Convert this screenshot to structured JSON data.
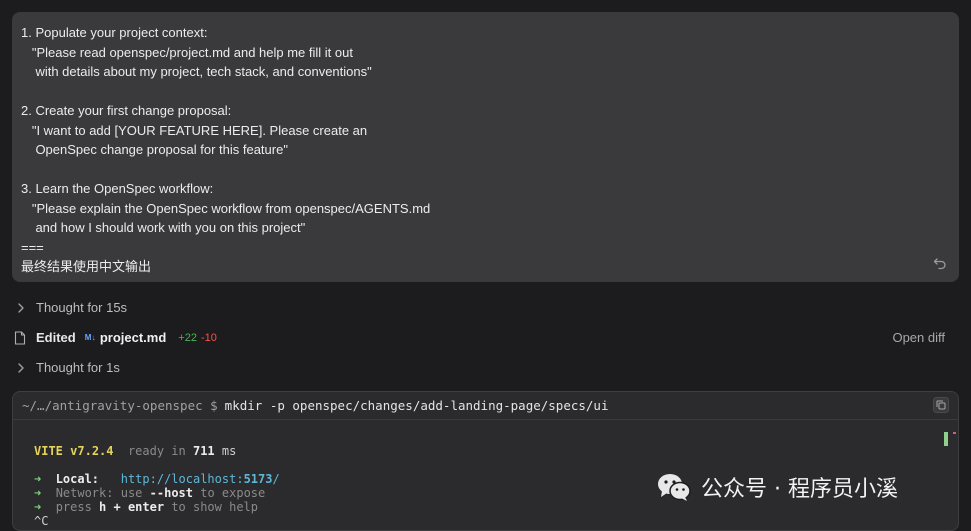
{
  "prompt": {
    "text": "1. Populate your project context:\n   \"Please read openspec/project.md and help me fill it out\n    with details about my project, tech stack, and conventions\"\n\n2. Create your first change proposal:\n   \"I want to add [YOUR FEATURE HERE]. Please create an\n    OpenSpec change proposal for this feature\"\n\n3. Learn the OpenSpec workflow:\n   \"Please explain the OpenSpec workflow from openspec/AGENTS.md\n    and how I should work with you on this project\"\n===\n最终结果使用中文输出"
  },
  "activity": {
    "thought1": "Thought for 15s",
    "edited_label": "Edited",
    "md_badge": "M↓",
    "file_name": "project.md",
    "adds": "+22",
    "dels": "-10",
    "open_diff": "Open diff",
    "thought2": "Thought for 1s"
  },
  "terminal": {
    "cwd": "~/…/antigravity-openspec $",
    "command": "mkdir -p openspec/changes/add-landing-page/specs/ui",
    "vite_name": "VITE",
    "vite_version": "v7.2.4",
    "ready_label": "ready in",
    "ready_ms": "711",
    "ms_unit": "ms",
    "arrow": "➜",
    "local_label": "Local:",
    "local_url_a": "http://localhost:",
    "local_url_port": "5173",
    "local_url_b": "/",
    "network_label": "Network:",
    "network_use": "use",
    "network_flag": "--host",
    "network_rest": "to expose",
    "press_label": "press",
    "help_key": "h + enter",
    "help_rest": "to show help",
    "ctrl_c": "^C"
  },
  "watermark": {
    "text": "公众号 · 程序员小溪",
    "icon": "wechat-icon"
  }
}
